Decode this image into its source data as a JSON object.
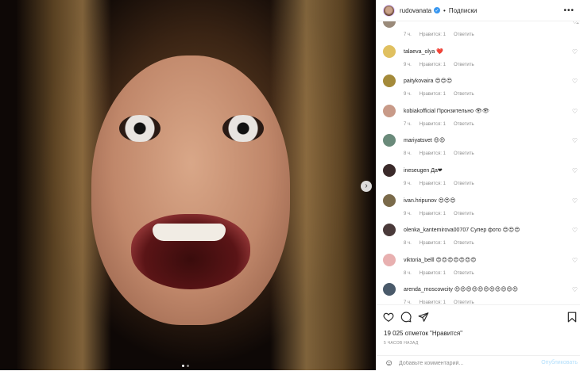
{
  "post": {
    "username": "rudovanata",
    "separator": "•",
    "follow_label": "Подписки",
    "more_label": "•••"
  },
  "comments": [
    {
      "user": "",
      "text": "",
      "time": "7 ч.",
      "likes": "Нравится: 1",
      "reply": "Ответить",
      "avatar_color": "#9a8a7a"
    },
    {
      "user": "talaeva_olya",
      "text": "❤️",
      "time": "9 ч.",
      "likes": "Нравится: 1",
      "reply": "Ответить",
      "avatar_color": "#e0c060"
    },
    {
      "user": "paitykovaira",
      "text": "😍😍😍",
      "time": "9 ч.",
      "likes": "Нравится: 1",
      "reply": "Ответить",
      "avatar_color": "#a48a3a"
    },
    {
      "user": "kobiakofficial",
      "text": "Пронзительно 👁👁",
      "time": "7 ч.",
      "likes": "Нравится: 1",
      "reply": "Ответить",
      "avatar_color": "#c89a88"
    },
    {
      "user": "mariyatsvet",
      "text": "😍😍",
      "time": "8 ч.",
      "likes": "Нравится: 1",
      "reply": "Ответить",
      "avatar_color": "#6a8a7a"
    },
    {
      "user": "ineseugen",
      "text": "Да❤",
      "time": "9 ч.",
      "likes": "Нравится: 1",
      "reply": "Ответить",
      "avatar_color": "#3a2a2a"
    },
    {
      "user": "ivan.hripunov",
      "text": "😍😍😍",
      "time": "9 ч.",
      "likes": "Нравится: 1",
      "reply": "Ответить",
      "avatar_color": "#7a6a4a"
    },
    {
      "user": "olenka_kantemirova00707",
      "text": "Супер фото 😍😍😍",
      "time": "8 ч.",
      "likes": "Нравится: 1",
      "reply": "Ответить",
      "avatar_color": "#4a3a3a"
    },
    {
      "user": "viktoria_belll",
      "text": "😍😍😍😍😍😍😍",
      "time": "8 ч.",
      "likes": "Нравится: 1",
      "reply": "Ответить",
      "avatar_color": "#e8b0b0"
    },
    {
      "user": "arenda_moscowcity",
      "text": "😍😍😍😍😍😍😍😍😍😍😍",
      "time": "7 ч.",
      "likes": "Нравится: 1",
      "reply": "Ответить",
      "avatar_color": "#4a5a6a"
    }
  ],
  "stats": {
    "likes_text": "19 025 отметок \"Нравится\"",
    "time_ago": "5 ЧАСОВ НАЗАД"
  },
  "add_comment": {
    "placeholder": "Добавьте комментарий...",
    "publish_label": "Опубликовать"
  },
  "icons": {
    "like": "heart-icon",
    "comment": "comment-icon",
    "share": "share-icon",
    "save": "bookmark-icon",
    "emoji": "emoji-icon",
    "next": "chevron-right-icon"
  },
  "carousel": {
    "total_slides": 2,
    "active_slide": 1
  }
}
